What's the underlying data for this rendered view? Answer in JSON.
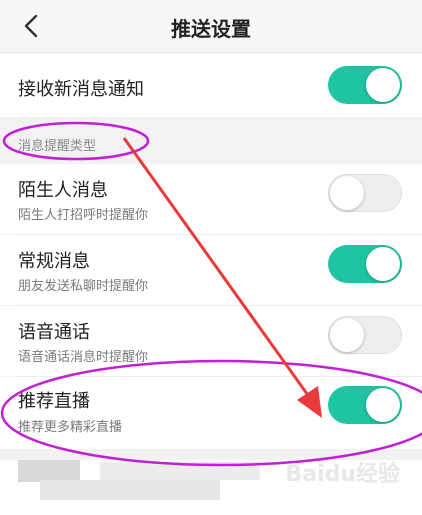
{
  "header": {
    "title": "推送设置"
  },
  "settings": {
    "new_message": {
      "label": "接收新消息通知",
      "enabled": true
    }
  },
  "section": {
    "label": "消息提醒类型"
  },
  "types": [
    {
      "label": "陌生人消息",
      "desc": "陌生人打招呼时提醒你",
      "enabled": false
    },
    {
      "label": "常规消息",
      "desc": "朋友发送私聊时提醒你",
      "enabled": true
    },
    {
      "label": "语音通话",
      "desc": "语音通话消息时提醒你",
      "enabled": false
    },
    {
      "label": "推荐直播",
      "desc": "推荐更多精彩直播",
      "enabled": true
    }
  ],
  "watermark": "Baidu经验",
  "colors": {
    "accent": "#1fc4a3",
    "annotation": "#c21fd6",
    "arrow": "#e83a3a"
  }
}
